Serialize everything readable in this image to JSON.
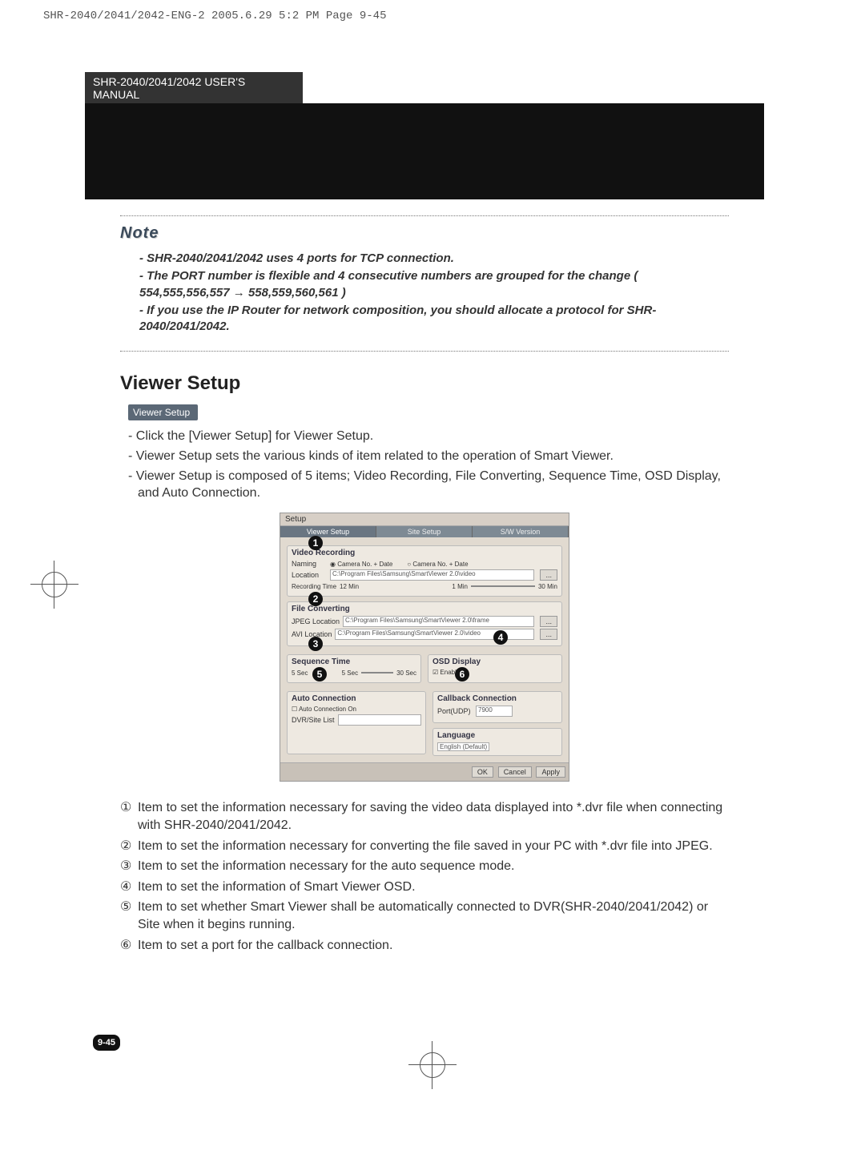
{
  "crop_mark": "SHR-2040/2041/2042-ENG-2  2005.6.29  5:2 PM  Page 9-45",
  "header_tab": "SHR-2040/2041/2042 USER'S MANUAL",
  "note": {
    "title": "Note",
    "lines": [
      "- SHR-2040/2041/2042 uses 4 ports for TCP connection.",
      "- The PORT number is flexible and 4 consecutive numbers are grouped for the change ( 554,555,556,557 → 558,559,560,561 )",
      "- If you use the IP Router for network composition, you should allocate a protocol for SHR-2040/2041/2042."
    ]
  },
  "section": {
    "title": "Viewer Setup",
    "button_label": "Viewer Setup",
    "bullets": [
      "- Click the [Viewer Setup] for Viewer Setup.",
      "- Viewer Setup sets the various kinds of item related to the operation of Smart Viewer.",
      "- Viewer Setup is composed of 5 items; Video Recording, File Converting, Sequence Time, OSD Display, and Auto Connection."
    ]
  },
  "screenshot": {
    "window_title": "Setup",
    "tabs": [
      "Viewer Setup",
      "Site Setup",
      "S/W Version"
    ],
    "groups": {
      "video_recording": {
        "title": "Video Recording",
        "naming_a": "Camera No. + Date",
        "naming_b": "Camera No. + Date",
        "location": "C:\\Program Files\\Samsung\\SmartViewer 2.0\\video",
        "rec_total": "12 Min",
        "rec_low": "1 Min",
        "rec_high": "30 Min"
      },
      "file_converting": {
        "title": "File Converting",
        "jpeg_loc": "C:\\Program Files\\Samsung\\SmartViewer 2.0\\frame",
        "avi_loc": "C:\\Program Files\\Samsung\\SmartViewer 2.0\\video"
      },
      "sequence_time": {
        "title": "Sequence Time",
        "low": "5 Sec",
        "cur": "5 Sec",
        "high": "30 Sec"
      },
      "osd_display": {
        "title": "OSD Display",
        "value": "Enable"
      },
      "auto_conn": {
        "title": "Auto Connection",
        "check": "Auto Connection On",
        "label": "DVR/Site List"
      },
      "callback": {
        "title": "Callback Connection",
        "label": "Port(UDP)",
        "value": "7900"
      },
      "language": {
        "title": "Language",
        "value": "English (Default)"
      }
    },
    "buttons": [
      "OK",
      "Cancel",
      "Apply"
    ]
  },
  "legend": [
    "Item to set the information necessary for saving the video data displayed into *.dvr file when connecting with SHR-2040/2041/2042.",
    "Item to set the information necessary for converting the file saved in your PC with *.dvr file into JPEG.",
    "Item to set the information necessary for the auto sequence mode.",
    "Item to set the information of Smart Viewer OSD.",
    "Item to set whether Smart Viewer shall be automatically connected to DVR(SHR-2040/2041/2042) or Site when it begins running.",
    "Item to set a port for the callback connection."
  ],
  "legend_markers": [
    "①",
    "②",
    "③",
    "④",
    "⑤",
    "⑥"
  ],
  "page_num": "9-45"
}
